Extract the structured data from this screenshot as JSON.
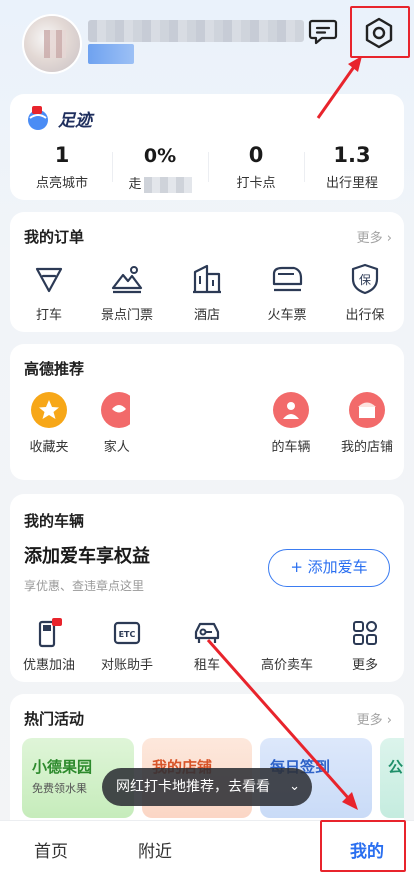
{
  "footprint": {
    "title": "足迹",
    "stats": [
      {
        "num": "1",
        "label": "点亮城市"
      },
      {
        "num": "0%",
        "label": "走"
      },
      {
        "num": "0",
        "label": "打卡点"
      },
      {
        "num": "1.3",
        "label": "出行里程"
      }
    ]
  },
  "orders": {
    "title": "我的订单",
    "more": "更多",
    "items": [
      {
        "label": "打车",
        "icon": "taxi-icon"
      },
      {
        "label": "景点门票",
        "icon": "scenic-ticket-icon"
      },
      {
        "label": "酒店",
        "icon": "hotel-icon"
      },
      {
        "label": "火车票",
        "icon": "train-icon"
      },
      {
        "label": "出行保",
        "icon": "insurance-icon"
      }
    ]
  },
  "recommend": {
    "title": "高德推荐",
    "items": [
      {
        "label": "收藏夹",
        "icon": "star-icon",
        "color": "#f7a718"
      },
      {
        "label": "家人:",
        "icon": "family-icon",
        "color": "#f26a6a"
      },
      {
        "label": "的车辆",
        "icon": "vehicle-icon",
        "color": "#f26a6a"
      },
      {
        "label": "我的店铺",
        "icon": "shop-icon",
        "color": "#f26a6a"
      }
    ]
  },
  "vehicle": {
    "title": "我的车辆",
    "headline": "添加爱车享权益",
    "subtitle": "享优惠、查违章点这里",
    "add_button": "+ 添加爱车",
    "items": [
      {
        "label": "优惠加油",
        "icon": "fuel-icon"
      },
      {
        "label": "对账助手",
        "icon": "etc-icon"
      },
      {
        "label": "租车",
        "icon": "rent-car-icon"
      },
      {
        "label": "高价卖车",
        "icon": "sell-car-icon"
      },
      {
        "label": "更多",
        "icon": "grid-more-icon"
      }
    ]
  },
  "hot": {
    "title": "热门活动",
    "more": "更多",
    "promos": [
      {
        "title": "小德果园",
        "sub": "免费领水果"
      },
      {
        "title": "我的店铺",
        "sub": ""
      },
      {
        "title": "每日签到",
        "sub": ""
      },
      {
        "title": "公",
        "sub": ""
      }
    ]
  },
  "toast": {
    "text": "网红打卡地推荐，去看看"
  },
  "tabs": {
    "home": "首页",
    "nearby": "附近",
    "mine": "我的"
  },
  "colors": {
    "accent": "#2a6ff0",
    "highlight": "#e8242c"
  }
}
